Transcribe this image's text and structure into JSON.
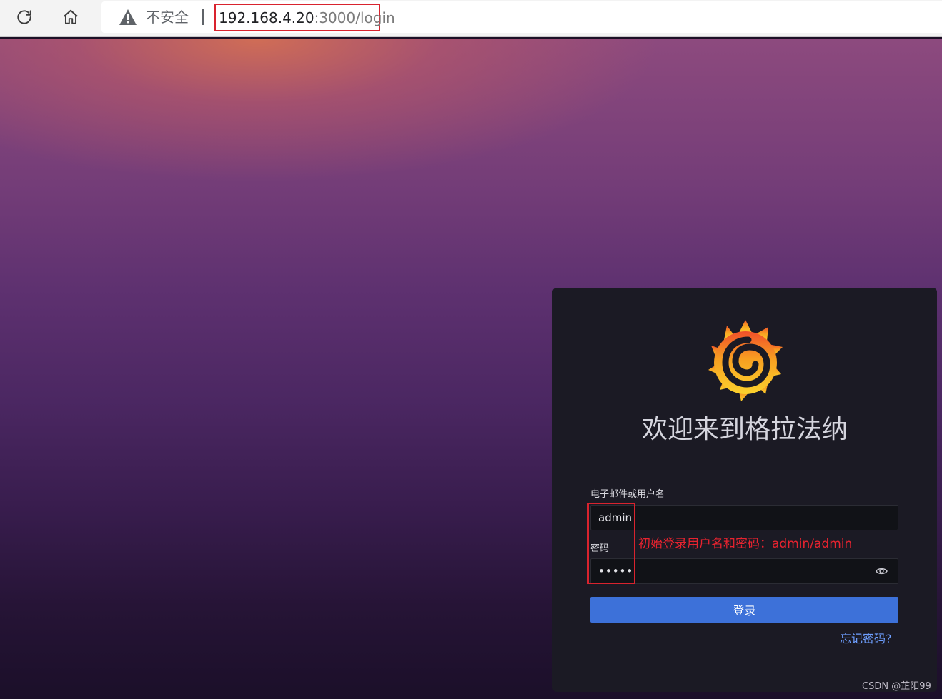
{
  "browser": {
    "reload_icon": "reload-icon",
    "home_icon": "home-icon",
    "security_icon": "warning-triangle-icon",
    "security_text": "不安全",
    "url_host": "192.168.4.20",
    "url_path": ":3000/login",
    "highlight_color": "#d9232e"
  },
  "login": {
    "logo_icon": "grafana-logo-icon",
    "title": "欢迎来到格拉法纳",
    "username_label": "电子邮件或用户名",
    "username_value": "admin",
    "password_label": "密码",
    "password_value": "admin",
    "password_toggle_icon": "eye-icon",
    "submit_label": "登录",
    "forgot_label": "忘记密码?",
    "accent_color": "#3d71d9",
    "link_color": "#6e9fff"
  },
  "annotation": {
    "text": "初始登录用户名和密码：admin/admin",
    "color": "#e8232f"
  },
  "watermark": {
    "text": "CSDN @芷阳99"
  }
}
